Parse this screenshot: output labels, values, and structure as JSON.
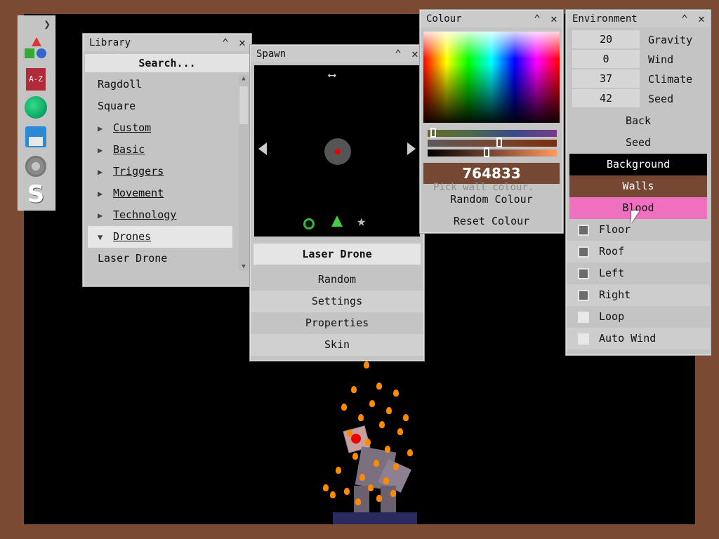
{
  "toolbar": {
    "collapse_icon": "chevron-right-icon",
    "tools": [
      "shapes-icon",
      "library-a-z-icon",
      "environment-globe-icon",
      "save-disk-icon",
      "settings-gear-icon",
      "script-s-icon"
    ]
  },
  "library": {
    "title": "Library",
    "search": "Search...",
    "items": [
      "Ragdoll",
      "Square"
    ],
    "categories": [
      "Custom ",
      "Basic",
      "Triggers",
      "Movement ",
      "Technology",
      "Drones"
    ],
    "sub_items": [
      "Laser Drone"
    ]
  },
  "spawn": {
    "title": "Spawn",
    "selected": "Laser Drone",
    "buttons": [
      "Random",
      "Settings",
      "Properties",
      "Skin"
    ]
  },
  "colour": {
    "title": "Colour",
    "hex": "764833",
    "hint": "Pick wall colour.",
    "buttons": [
      "Random Colour",
      "Reset Colour"
    ],
    "hex_color": "#764833"
  },
  "environment": {
    "title": "Environment",
    "fields": [
      {
        "value": "20",
        "label": "Gravity"
      },
      {
        "value": "0",
        "label": "Wind"
      },
      {
        "value": "37",
        "label": "Climate"
      },
      {
        "value": "42",
        "label": "Seed"
      }
    ],
    "buttons": [
      "Back",
      "Seed"
    ],
    "colour_targets": [
      {
        "label": "Background",
        "bg": "#000000",
        "fg": "#ffffff"
      },
      {
        "label": "Walls",
        "bg": "#764833",
        "fg": "#ffffff"
      },
      {
        "label": "Blood",
        "bg": "#f070c0",
        "fg": "#111111"
      }
    ],
    "checkboxes": [
      {
        "label": "Floor",
        "checked": true
      },
      {
        "label": "Roof",
        "checked": true
      },
      {
        "label": "Left",
        "checked": true
      },
      {
        "label": "Right",
        "checked": true
      },
      {
        "label": "Loop",
        "checked": false
      },
      {
        "label": "Auto Wind",
        "checked": false
      }
    ]
  }
}
